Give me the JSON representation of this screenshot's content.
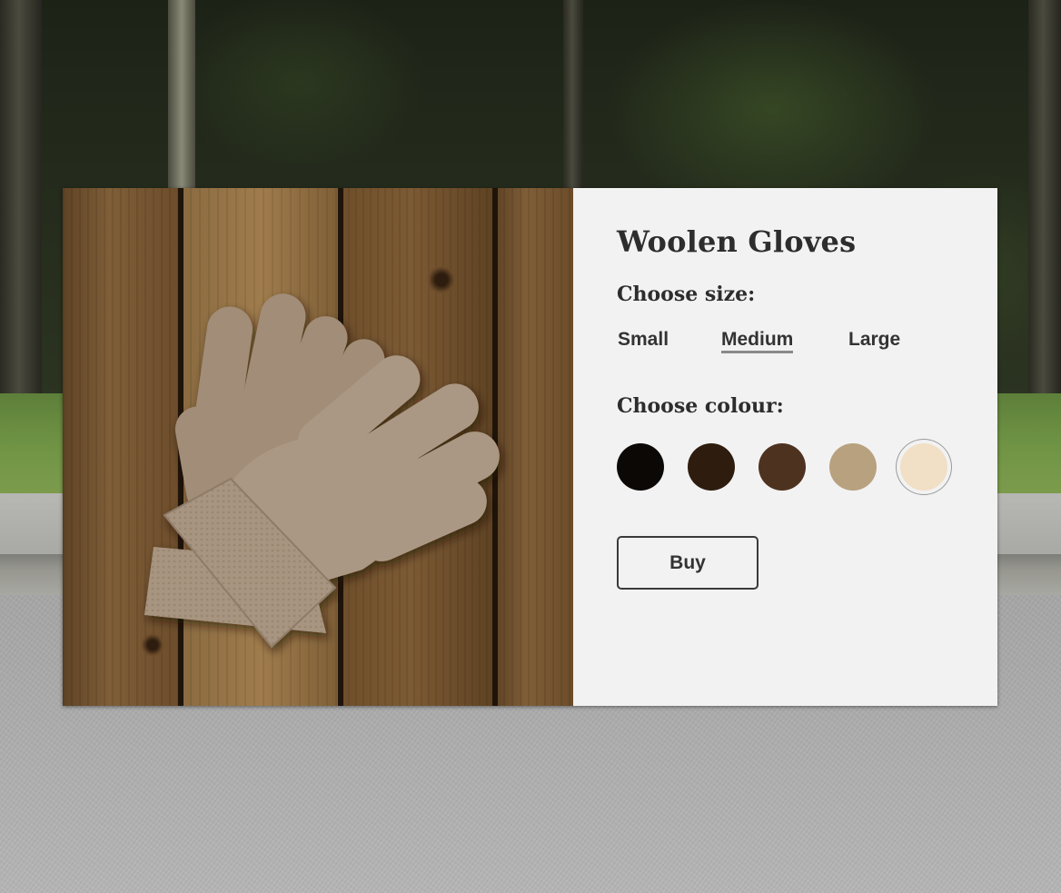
{
  "product": {
    "name": "Woolen Gloves",
    "size_heading": "Choose size:",
    "sizes": [
      {
        "label": "Small",
        "selected": false
      },
      {
        "label": "Medium",
        "selected": true
      },
      {
        "label": "Large",
        "selected": false
      }
    ],
    "colour_heading": "Choose colour:",
    "colours": [
      {
        "name": "black",
        "hex": "#0c0806",
        "selected": false
      },
      {
        "name": "dark-brown",
        "hex": "#2e1c0e",
        "selected": false
      },
      {
        "name": "brown",
        "hex": "#4e3220",
        "selected": false
      },
      {
        "name": "tan",
        "hex": "#b8a17e",
        "selected": false
      },
      {
        "name": "cream",
        "hex": "#f1dfc6",
        "selected": true
      }
    ],
    "buy_label": "Buy"
  },
  "colors": {
    "panel_background": "#f2f2f2",
    "text": "#2d2d2d",
    "glove": "#a89581"
  }
}
